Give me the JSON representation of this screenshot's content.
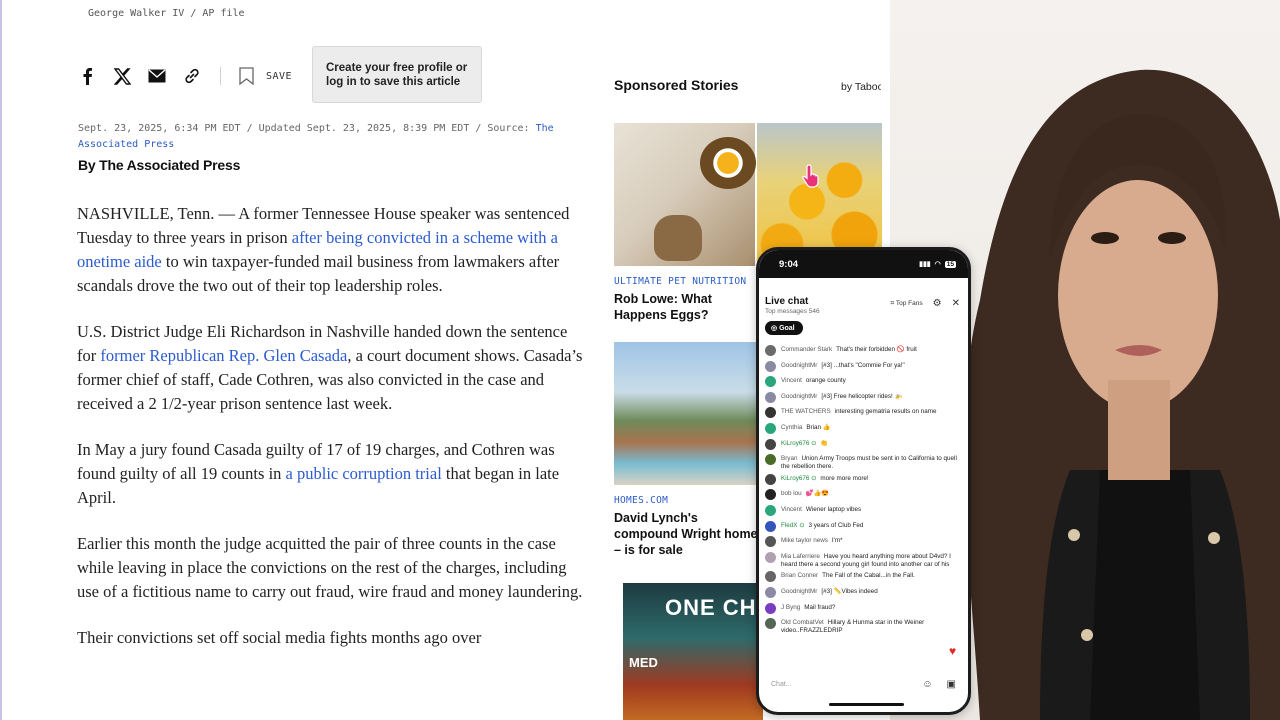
{
  "article": {
    "photo_credit": "George Walker IV / AP file",
    "share": {
      "save_label": "SAVE"
    },
    "save_tooltip": "Create your free profile or log in to save this article",
    "meta": {
      "date_line": "Sept. 23, 2025, 6:34 PM EDT / Updated Sept. 23, 2025, 8:39 PM EDT / Source: ",
      "source_link": "The Associated Press"
    },
    "byline": "By The Associated Press",
    "paragraphs": [
      {
        "pre": "NASHVILLE, Tenn. — A former Tennessee House speaker was sentenced Tuesday to three years in prison ",
        "link": "after being convicted in a scheme with a onetime aide",
        "post": " to win taxpayer-funded mail business from lawmakers after scandals drove the two out of their top leadership roles."
      },
      {
        "pre": "U.S. District Judge Eli Richardson in Nashville handed down the sentence for ",
        "link": "former Republican Rep. Glen Casada",
        "post": ", a court document shows. Casada’s former chief of staff, Cade Cothren, was also convicted in the case and received a 2 1/2-year prison sentence last week."
      },
      {
        "pre": "In May a jury found Casada guilty of 17 of 19 charges, and Cothren was found guilty of all 19 counts in ",
        "link": "a public corruption trial",
        "post": " that began in late April."
      },
      {
        "pre": "Earlier this month the judge acquitted the pair of three counts in the case while leaving in place the convictions on the rest of the charges, including use of a fictitious name to carry out fraud, wire fraud and money laundering.",
        "link": "",
        "post": ""
      },
      {
        "pre": "Their convictions set off social media fights months ago over",
        "link": "",
        "post": ""
      }
    ]
  },
  "sponsored": {
    "title": "Sponsored Stories",
    "by": "by Taboola",
    "cards": [
      {
        "source": "ULTIMATE PET NUTRITION",
        "headline": "Rob Lowe: What Happens Eggs?"
      },
      {
        "source": "HOMES.COM",
        "headline": "David Lynch's compound Wright home – is for sale"
      },
      {
        "tv_text": "ONE CH",
        "tv_sub": "MED"
      }
    ]
  },
  "phone": {
    "time": "9:04",
    "battery": "15",
    "chat_title": "Live chat",
    "chat_sub": "Top messages  546",
    "top_fans": "Top Fans",
    "goal": "Goal",
    "input_placeholder": "Chat...",
    "messages": [
      {
        "author": "Commander Stark",
        "text": "That's their forbidden 🚫 fruit",
        "color": "#6b6b6b",
        "green": false
      },
      {
        "author": "GoodnightMr",
        "text": "[#3]  ...that's \"Commie For ya!\"",
        "color": "#8a8aa5",
        "green": false
      },
      {
        "author": "Vincent",
        "text": "orange county",
        "color": "#2aa67c",
        "green": false
      },
      {
        "author": "GoodnightMr",
        "text": "[#3]  Free helicopter rides! 🚁",
        "color": "#8a8aa5",
        "green": false
      },
      {
        "author": "THE WATCHERS",
        "text": "interesting gematria results on name",
        "color": "#333333",
        "green": false
      },
      {
        "author": "Cynthia",
        "text": "Brian 👍",
        "color": "#2aa67c",
        "green": false
      },
      {
        "author": "KiLroy676 ⊙",
        "text": "👏",
        "color": "#444444",
        "green": true
      },
      {
        "author": "Bryan",
        "text": "Union Army Troops must be sent in to California to quell the rebellion there.",
        "color": "#4b6b2a",
        "green": false
      },
      {
        "author": "KiLroy676 ⊙",
        "text": "more more more!",
        "color": "#444444",
        "green": true
      },
      {
        "author": "bob lou",
        "text": "💕👍😍",
        "color": "#222222",
        "green": false
      },
      {
        "author": "Vincent",
        "text": "Wiener laptop vibes",
        "color": "#2aa67c",
        "green": false
      },
      {
        "author": "FledX ⊙",
        "text": "3 years of Club Fed",
        "color": "#3355bb",
        "green": true
      },
      {
        "author": "Mike taylor news",
        "text": "I'm*",
        "color": "#555555",
        "green": false
      },
      {
        "author": "Mia Laferriere",
        "text": "Have you heard anything more about D4vd? I heard there a second young girl found into another car of his",
        "color": "#b0a0b0",
        "green": false
      },
      {
        "author": "Brian Conner",
        "text": "The Fall of the Cabal...in the Fall.",
        "color": "#666666",
        "green": false
      },
      {
        "author": "GoodnightMr",
        "text": "[#3]  📏Vibes indeed",
        "color": "#8a8aa5",
        "green": false
      },
      {
        "author": "J Byng",
        "text": "Mail fraud?",
        "color": "#7a3cc0",
        "green": false
      },
      {
        "author": "Old CombatVet",
        "text": "Hillary & Hunma star in the Weiner video..FRAZZLEDRIP",
        "color": "#556655",
        "green": false
      }
    ]
  },
  "colors": {
    "link": "#2b5bd0",
    "tooltip_bg": "#ececec",
    "presenter_bg": "#efebe7"
  }
}
